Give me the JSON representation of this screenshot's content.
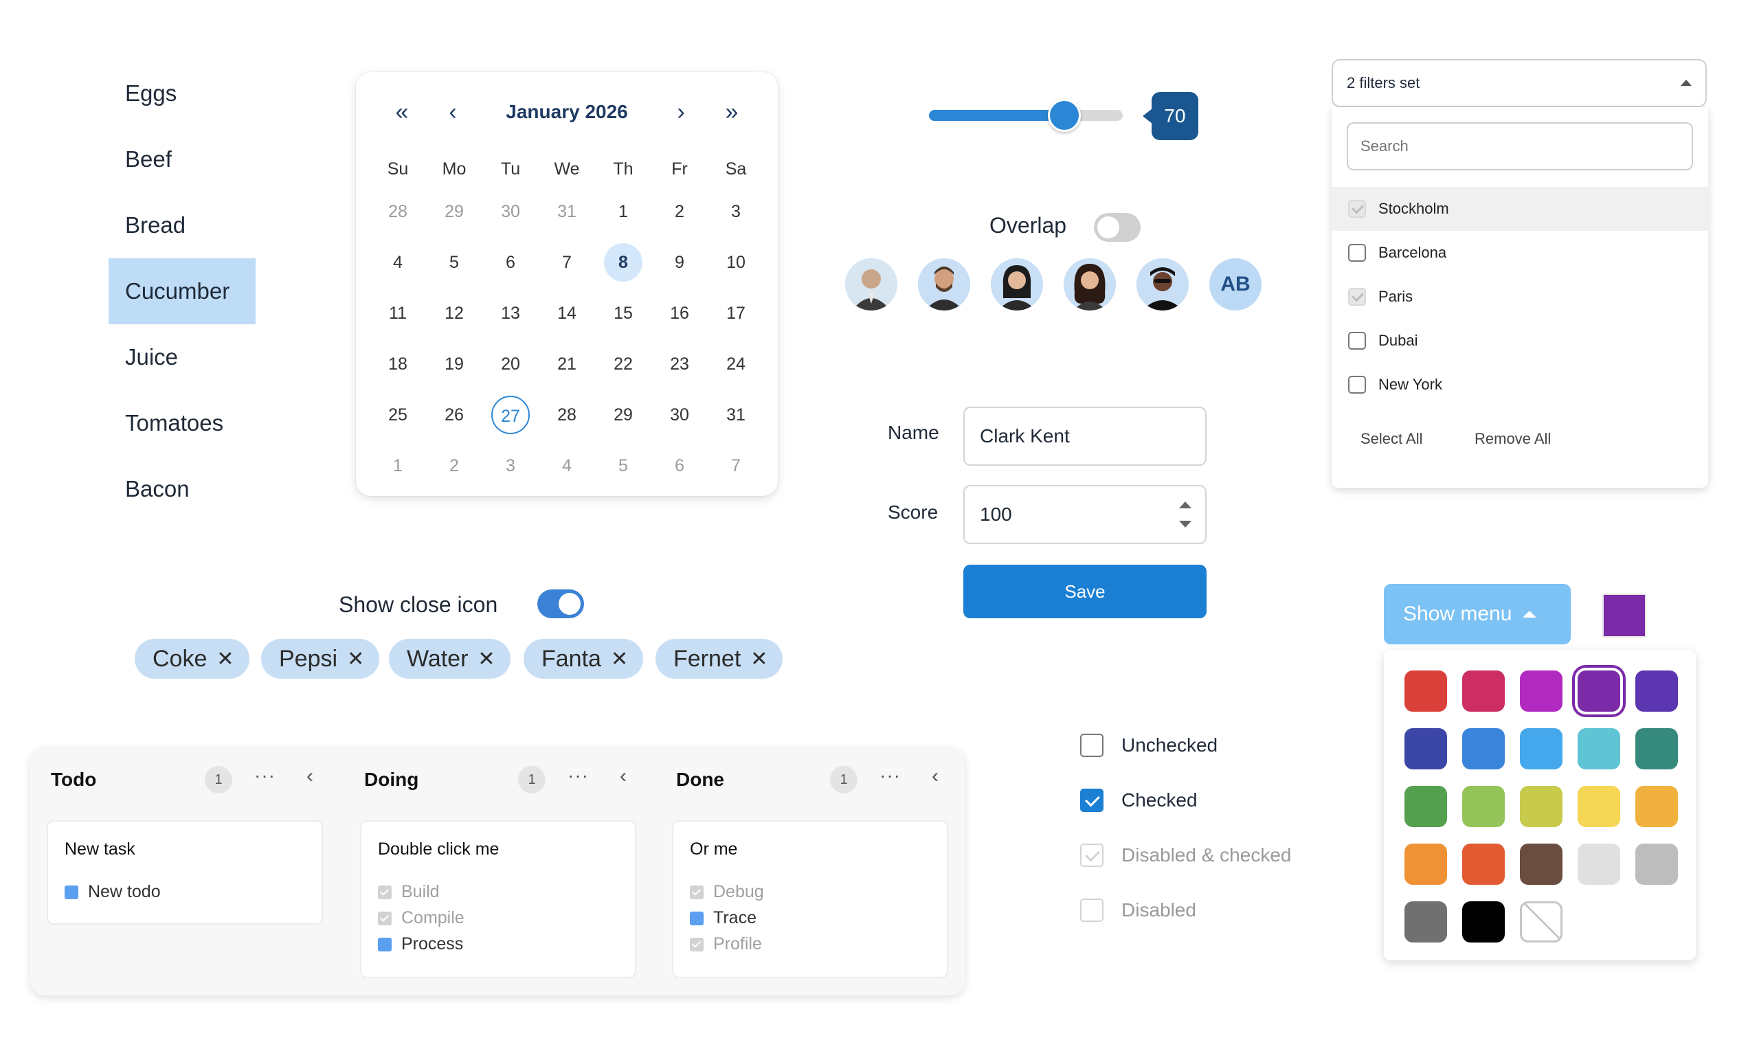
{
  "list": {
    "items": [
      "Eggs",
      "Beef",
      "Bread",
      "Cucumber",
      "Juice",
      "Tomatoes",
      "Bacon"
    ],
    "selected": "Cucumber"
  },
  "calendar": {
    "title": "January 2026",
    "nav": {
      "prev_year": "«",
      "prev_month": "‹",
      "next_month": "›",
      "next_year": "»"
    },
    "weekdays": [
      "Su",
      "Mo",
      "Tu",
      "We",
      "Th",
      "Fr",
      "Sa"
    ],
    "weeks": [
      [
        "28",
        "29",
        "30",
        "31",
        "1",
        "2",
        "3"
      ],
      [
        "4",
        "5",
        "6",
        "7",
        "8",
        "9",
        "10"
      ],
      [
        "11",
        "12",
        "13",
        "14",
        "15",
        "16",
        "17"
      ],
      [
        "18",
        "19",
        "20",
        "21",
        "22",
        "23",
        "24"
      ],
      [
        "25",
        "26",
        "27",
        "28",
        "29",
        "30",
        "31"
      ],
      [
        "1",
        "2",
        "3",
        "4",
        "5",
        "6",
        "7"
      ]
    ],
    "today": "8",
    "selected": "27"
  },
  "slider": {
    "value": 70,
    "min": 0,
    "max": 100,
    "value_label": "70"
  },
  "overlap": {
    "label": "Overlap",
    "on": false
  },
  "avatars": {
    "initials": "AB"
  },
  "filter": {
    "summary": "2 filters set",
    "search_placeholder": "Search",
    "options": [
      {
        "label": "Stockholm",
        "checked": true,
        "disabled": true
      },
      {
        "label": "Barcelona",
        "checked": false
      },
      {
        "label": "Paris",
        "checked": true,
        "disabled": true
      },
      {
        "label": "Dubai",
        "checked": false
      },
      {
        "label": "New York",
        "checked": false
      }
    ],
    "select_all": "Select All",
    "remove_all": "Remove All"
  },
  "form": {
    "name_label": "Name",
    "name_value": "Clark Kent",
    "score_label": "Score",
    "score_value": "100",
    "save_label": "Save"
  },
  "chips": {
    "toggle_label": "Show close icon",
    "toggle_on": true,
    "items": [
      "Coke",
      "Pepsi",
      "Water",
      "Fanta",
      "Fernet"
    ],
    "close_glyph": "✕"
  },
  "kanban": {
    "columns": [
      {
        "title": "Todo",
        "count": "1",
        "card": {
          "title": "New task",
          "items": [
            {
              "label": "New todo",
              "done": false
            }
          ]
        }
      },
      {
        "title": "Doing",
        "count": "1",
        "card": {
          "title": "Double click me",
          "items": [
            {
              "label": "Build",
              "done": true
            },
            {
              "label": "Compile",
              "done": true
            },
            {
              "label": "Process",
              "done": false
            }
          ]
        }
      },
      {
        "title": "Done",
        "count": "1",
        "card": {
          "title": "Or me",
          "items": [
            {
              "label": "Debug",
              "done": true
            },
            {
              "label": "Trace",
              "done": false
            },
            {
              "label": "Profile",
              "done": true
            }
          ]
        }
      }
    ],
    "more_glyph": "···",
    "collapse_glyph": "‹"
  },
  "checkboxes": [
    {
      "label": "Unchecked",
      "state": "unchecked"
    },
    {
      "label": "Checked",
      "state": "checked"
    },
    {
      "label": "Disabled & checked",
      "state": "disabled-checked"
    },
    {
      "label": "Disabled",
      "state": "disabled"
    }
  ],
  "color_menu": {
    "button_label": "Show menu",
    "picked_color": "#7b2aa8",
    "colors": [
      "#d9413a",
      "#cc2e63",
      "#b02ac0",
      "#7b2aa8",
      "#5c35b0",
      "#3c46a6",
      "#3b84dc",
      "#45a8ec",
      "#5fc4d4",
      "#368a7d",
      "#54a04e",
      "#94c45a",
      "#c7ca4b",
      "#f5d755",
      "#f1b13e",
      "#ee9235",
      "#e25b33",
      "#6b4d40",
      "#e0e0e0",
      "#bdbdbd",
      "#707070",
      "#000000",
      "none"
    ],
    "selected_color": "#7b2aa8"
  }
}
